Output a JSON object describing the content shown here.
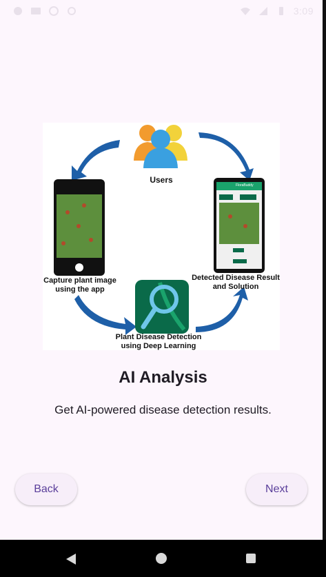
{
  "status_bar": {
    "time": "3:09",
    "icons": [
      "notification-icon",
      "gallery-icon",
      "data-saver-icon",
      "circle-icon",
      "wifi-icon",
      "signal-icon",
      "battery-icon"
    ]
  },
  "illustration": {
    "users_label": "Users",
    "capture_label_line1": "Capture plant image",
    "capture_label_line2": "using the app",
    "detection_label_line1": "Plant Disease Detection",
    "detection_label_line2": "using Deep Learning",
    "result_label_line1": "Detected Disease Result",
    "result_label_line2": "and Solution",
    "phone_app_title": "FloraBuddy"
  },
  "main": {
    "title": "AI Analysis",
    "subtitle": "Get AI-powered disease detection results."
  },
  "buttons": {
    "back": "Back",
    "next": "Next"
  },
  "colors": {
    "background": "#fdf6fd",
    "accent": "#5a3e9a",
    "arrow_blue": "#1e5fa8",
    "teal": "#1aa36c"
  }
}
